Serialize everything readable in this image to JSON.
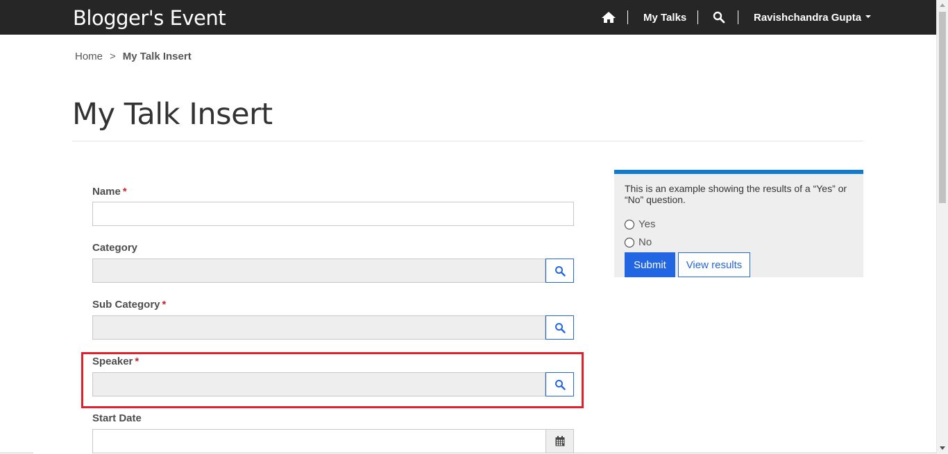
{
  "navbar": {
    "brand": "Blogger's Event",
    "home_icon": "home-icon",
    "my_talks": "My Talks",
    "search_icon": "search-icon",
    "user_name": "Ravishchandra Gupta"
  },
  "breadcrumb": {
    "home": "Home",
    "separator": ">",
    "current": "My Talk Insert"
  },
  "page": {
    "title": "My Talk Insert"
  },
  "form": {
    "name_label": "Name",
    "category_label": "Category",
    "sub_category_label": "Sub Category",
    "speaker_label": "Speaker",
    "start_date_label": "Start Date",
    "required_mark": "*",
    "lookup_icon": "search-icon",
    "calendar_icon": "calendar-icon"
  },
  "poll": {
    "question": "This is an example showing the results of a “Yes” or “No” question.",
    "option_yes": "Yes",
    "option_no": "No",
    "submit_label": "Submit",
    "view_results_label": "View results"
  },
  "colors": {
    "navbar_bg": "#262626",
    "primary": "#2266e3",
    "poll_accent": "#0e7ad0",
    "highlight": "#e0212b",
    "required": "#c1272d"
  }
}
